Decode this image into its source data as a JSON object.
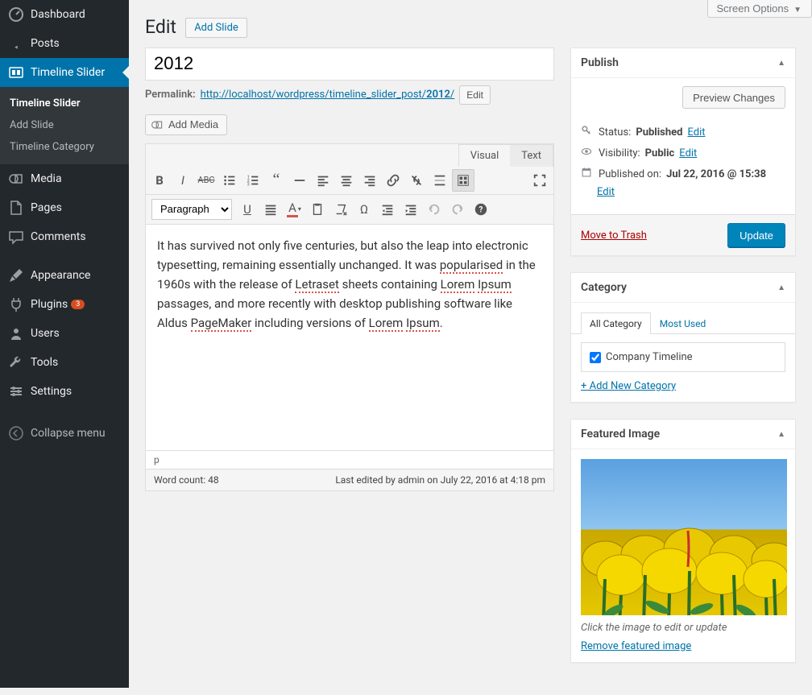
{
  "screen_options_label": "Screen Options",
  "sidebar": {
    "items": [
      {
        "label": "Dashboard",
        "icon": "dashboard"
      },
      {
        "label": "Posts",
        "icon": "pin"
      },
      {
        "label": "Timeline Slider",
        "icon": "timeline",
        "current": true
      },
      {
        "label": "Media",
        "icon": "media"
      },
      {
        "label": "Pages",
        "icon": "page"
      },
      {
        "label": "Comments",
        "icon": "comment"
      },
      {
        "label": "Appearance",
        "icon": "brush"
      },
      {
        "label": "Plugins",
        "icon": "plug",
        "badge": "3"
      },
      {
        "label": "Users",
        "icon": "user"
      },
      {
        "label": "Tools",
        "icon": "wrench"
      },
      {
        "label": "Settings",
        "icon": "settings"
      }
    ],
    "submenu": [
      {
        "label": "Timeline Slider",
        "current": true
      },
      {
        "label": "Add Slide"
      },
      {
        "label": "Timeline Category"
      }
    ],
    "collapse_label": "Collapse menu"
  },
  "page": {
    "title": "Edit",
    "add_new_label": "Add Slide",
    "post_title": "2012",
    "permalink_label": "Permalink:",
    "permalink_base": "http://localhost/wordpress/timeline_slider_post/",
    "permalink_slug": "2012",
    "permalink_suffix": "/",
    "edit_btn": "Edit"
  },
  "editor": {
    "add_media": "Add Media",
    "tabs": {
      "visual": "Visual",
      "text": "Text"
    },
    "format_select": "Paragraph",
    "content_part1": "It has survived not only five centuries, but also the leap into electronic typesetting, remaining essentially unchanged. It was ",
    "w1": "popularised",
    "content_part2": " in the 1960s with the release of ",
    "w2": "Letraset",
    "content_part3": " sheets containing ",
    "w3": "Lorem",
    "sp": " ",
    "w4": "Ipsum",
    "content_part4": " passages, and more recently with desktop publishing software like Aldus ",
    "w5": "PageMaker",
    "content_part5": " including versions of ",
    "w6": "Lorem",
    "w7": "Ipsum",
    "content_part6": ".",
    "path": "p",
    "word_count_label": "Word count: 48",
    "last_edited": "Last edited by admin on July 22, 2016 at 4:18 pm"
  },
  "publish": {
    "title": "Publish",
    "preview_btn": "Preview Changes",
    "status_label": "Status:",
    "status_value": "Published",
    "visibility_label": "Visibility:",
    "visibility_value": "Public",
    "published_label": "Published on:",
    "published_value": "Jul 22, 2016 @ 15:38",
    "edit_link": "Edit",
    "trash_label": "Move to Trash",
    "update_btn": "Update"
  },
  "category": {
    "title": "Category",
    "tabs": {
      "all": "All Category",
      "most": "Most Used"
    },
    "items": [
      {
        "label": "Company Timeline",
        "checked": true
      }
    ],
    "add_new": "+ Add New Category"
  },
  "featured": {
    "title": "Featured Image",
    "caption": "Click the image to edit or update",
    "remove": "Remove featured image"
  }
}
